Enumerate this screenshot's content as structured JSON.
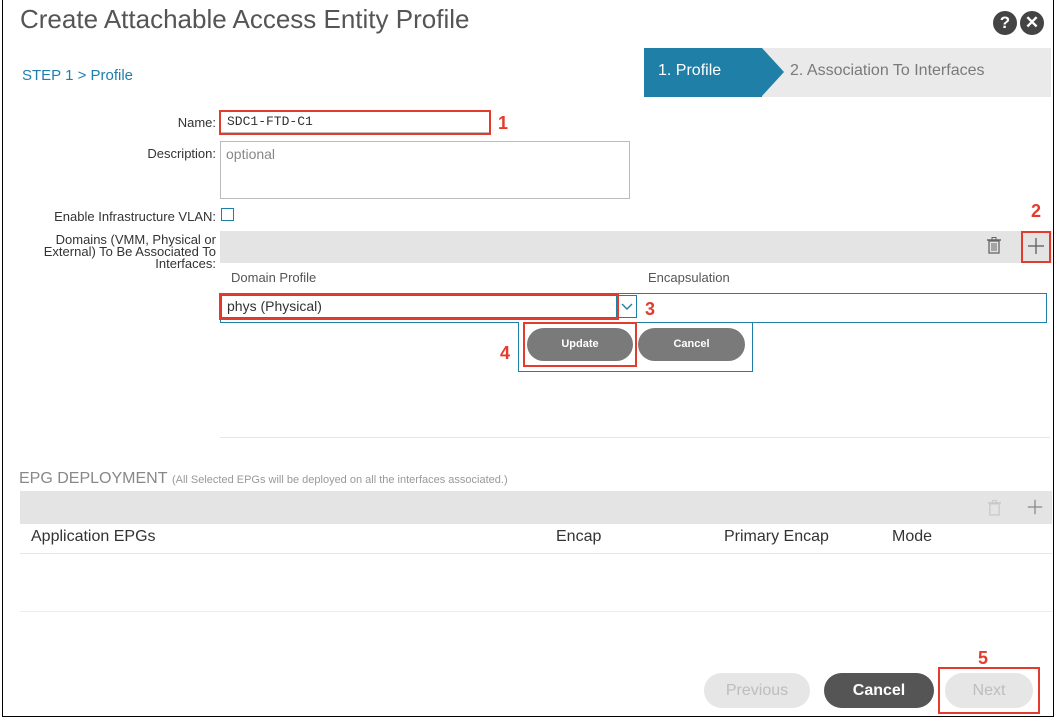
{
  "window": {
    "title": "Create Attachable Access Entity Profile"
  },
  "header_icons": {
    "help": "?",
    "close": "✕"
  },
  "step_label": "STEP 1 > Profile",
  "wizard": {
    "step1": "1. Profile",
    "step2": "2. Association To Interfaces"
  },
  "form": {
    "name_label": "Name:",
    "name_value": "SDC1-FTD-C1",
    "description_label": "Description:",
    "description_placeholder": "optional",
    "infra_vlan_label": "Enable Infrastructure VLAN:",
    "domains_label": "Domains (VMM, Physical or External) To Be Associated To Interfaces:"
  },
  "domains_table": {
    "col_domain_profile": "Domain Profile",
    "col_encapsulation": "Encapsulation",
    "selected_domain": "phys (Physical)",
    "update_label": "Update",
    "cancel_label": "Cancel"
  },
  "epg": {
    "title": "EPG DEPLOYMENT",
    "subtitle": "(All Selected EPGs will be deployed on all the interfaces associated.)",
    "col_app_epgs": "Application EPGs",
    "col_encap": "Encap",
    "col_primary_encap": "Primary Encap",
    "col_mode": "Mode"
  },
  "footer": {
    "previous": "Previous",
    "cancel": "Cancel",
    "next": "Next"
  },
  "annotations": {
    "n1": "1",
    "n2": "2",
    "n3": "3",
    "n4": "4",
    "n5": "5"
  },
  "icons": {
    "trash": "trash-icon",
    "plus": "plus-icon",
    "chevron": "chevron-down-icon"
  },
  "colors": {
    "accent": "#1f7fa6",
    "annotation": "#e53b2c",
    "link": "#1e7fad"
  }
}
